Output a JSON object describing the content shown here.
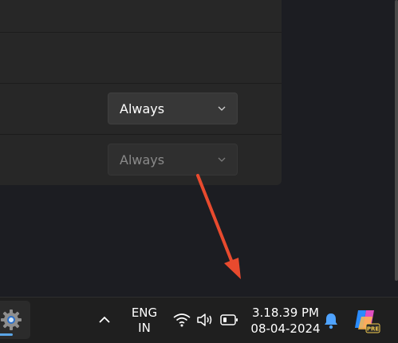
{
  "settings": {
    "row3_dropdown": {
      "value": "Always"
    },
    "row4_dropdown": {
      "value": "Always",
      "disabled": true
    }
  },
  "taskbar": {
    "pinned_app_icon": "gear-icon",
    "language": {
      "line1": "ENG",
      "line2": "IN"
    },
    "clock": {
      "time": "3.18.39 PM",
      "date": "08-04-2024"
    },
    "tray_icons": [
      "chevron-up-icon",
      "wifi-icon",
      "volume-icon",
      "battery-icon",
      "bell-icon",
      "copilot-icon"
    ],
    "copilot_badge": "PRE"
  },
  "annotation": {
    "color": "#e84a2e"
  },
  "colors": {
    "accent": "#5aa5e6",
    "bell": "#4fa3ff"
  }
}
